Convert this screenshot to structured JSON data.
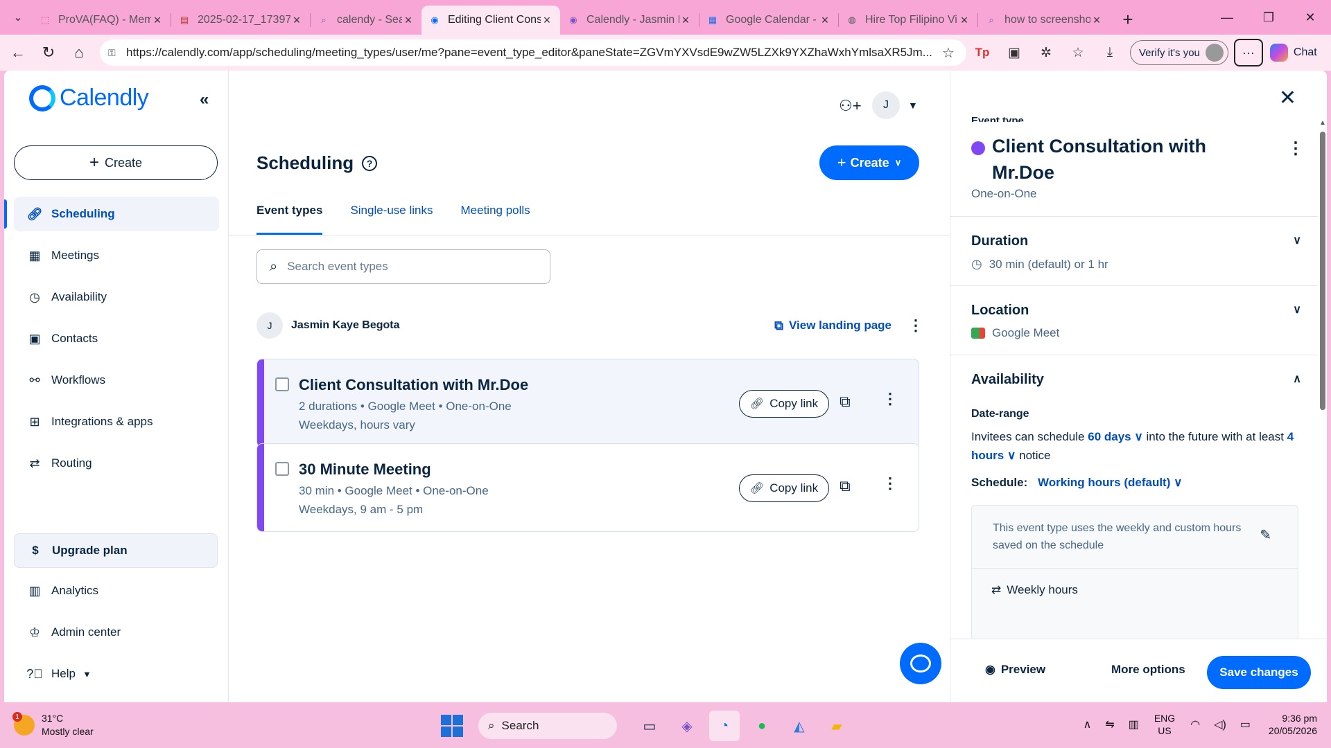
{
  "browser": {
    "tabs": [
      {
        "title": "ProVA(FAQ) - Mem",
        "icon": "doc-icon",
        "active": false
      },
      {
        "title": "2025-02-17_17397",
        "icon": "pdf-icon",
        "active": false
      },
      {
        "title": "calendy - Search",
        "icon": "search-icon",
        "active": false
      },
      {
        "title": "Editing Client Consu",
        "icon": "calendly-icon",
        "active": true
      },
      {
        "title": "Calendly - Jasmin K",
        "icon": "calendly-icon",
        "active": false
      },
      {
        "title": "Google Calendar -",
        "icon": "calendar-icon",
        "active": false
      },
      {
        "title": "Hire Top Filipino Vi",
        "icon": "globe-icon",
        "active": false
      },
      {
        "title": "how to screenshot",
        "icon": "search-icon",
        "active": false
      }
    ],
    "url": "https://calendly.com/app/scheduling/meeting_types/user/me?pane=event_type_editor&paneState=ZGVmYXVsdE9wZW5LZXk9YXZhaWxhYmlsaXR5Jm...",
    "verify_label": "Verify it's you",
    "chat_label": "Chat"
  },
  "sidebar": {
    "logo_text": "Calendly",
    "create_label": "Create",
    "items": [
      {
        "label": "Scheduling",
        "icon": "link-icon",
        "active": true
      },
      {
        "label": "Meetings",
        "icon": "calendar-icon",
        "active": false
      },
      {
        "label": "Availability",
        "icon": "clock-icon",
        "active": false
      },
      {
        "label": "Contacts",
        "icon": "contacts-icon",
        "active": false
      },
      {
        "label": "Workflows",
        "icon": "workflow-icon",
        "active": false
      },
      {
        "label": "Integrations & apps",
        "icon": "grid-icon",
        "active": false
      },
      {
        "label": "Routing",
        "icon": "routing-icon",
        "active": false
      }
    ],
    "upgrade_label": "Upgrade plan",
    "bottom_items": [
      {
        "label": "Analytics",
        "icon": "analytics-icon"
      },
      {
        "label": "Admin center",
        "icon": "admin-icon"
      },
      {
        "label": "Help",
        "icon": "help-icon"
      }
    ]
  },
  "main": {
    "avatar_initial": "J",
    "title": "Scheduling",
    "create_label": "Create",
    "tabs": [
      {
        "label": "Event types",
        "active": true
      },
      {
        "label": "Single-use links",
        "active": false
      },
      {
        "label": "Meeting polls",
        "active": false
      }
    ],
    "search_placeholder": "Search event types",
    "owner": {
      "initial": "J",
      "name": "Jasmin Kaye Begota",
      "landing_label": "View landing page"
    },
    "events": [
      {
        "name": "Client Consultation with Mr.Doe",
        "meta": "2 durations • Google Meet • One-on-One",
        "schedule": "Weekdays, hours vary",
        "copy_label": "Copy link",
        "color": "#8247f5",
        "highlighted": true
      },
      {
        "name": "30 Minute Meeting",
        "meta": "30 min • Google Meet • One-on-One",
        "schedule": "Weekdays, 9 am - 5 pm",
        "copy_label": "Copy link",
        "color": "#8247f5",
        "highlighted": false
      }
    ]
  },
  "panel": {
    "label": "Event type",
    "title": "Client Consultation with Mr.Doe",
    "kind": "One-on-One",
    "duration": {
      "heading": "Duration",
      "value": "30 min (default) or 1 hr"
    },
    "location": {
      "heading": "Location",
      "value": "Google Meet"
    },
    "availability": {
      "heading": "Availability",
      "date_range_label": "Date-range",
      "text_a": "Invitees can schedule",
      "days": "60 days",
      "text_b": "into the future with at least",
      "hours": "4 hours",
      "text_c": "notice",
      "schedule_label": "Schedule:",
      "schedule_value": "Working hours (default)",
      "note": "This event type uses the weekly and custom hours saved on the schedule",
      "weekly_label": "Weekly hours"
    },
    "footer": {
      "preview": "Preview",
      "more": "More options",
      "save": "Save changes"
    }
  },
  "taskbar": {
    "temp": "31°C",
    "weather": "Mostly clear",
    "notif": "1",
    "search": "Search",
    "lang1": "ENG",
    "lang2": "US",
    "time": "9:36 pm",
    "date": "20/05/2026"
  },
  "colors": {
    "brand": "#006bff",
    "event": "#8247f5",
    "text": "#0a2540"
  }
}
